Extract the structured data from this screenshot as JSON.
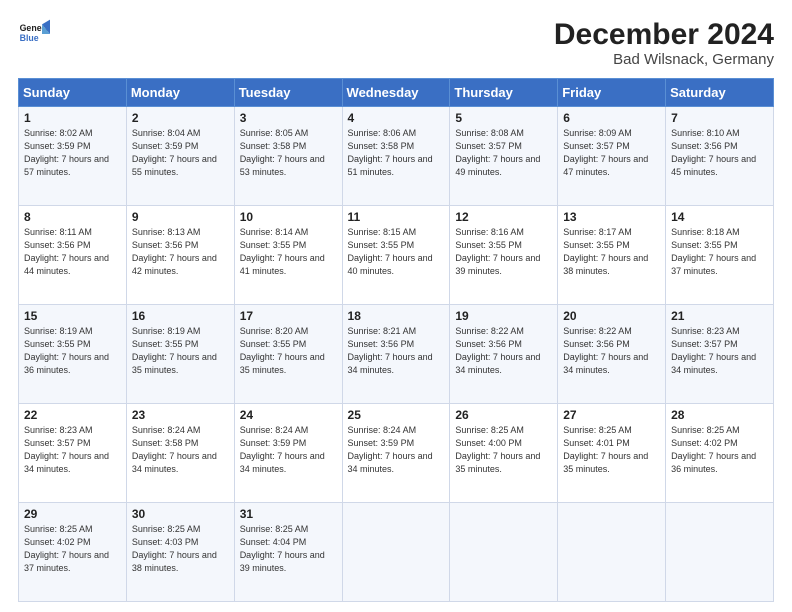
{
  "logo": {
    "line1": "General",
    "line2": "Blue"
  },
  "title": "December 2024",
  "subtitle": "Bad Wilsnack, Germany",
  "days": [
    "Sunday",
    "Monday",
    "Tuesday",
    "Wednesday",
    "Thursday",
    "Friday",
    "Saturday"
  ],
  "weeks": [
    [
      {
        "day": "1",
        "sunrise": "8:02 AM",
        "sunset": "3:59 PM",
        "daylight": "7 hours and 57 minutes."
      },
      {
        "day": "2",
        "sunrise": "8:04 AM",
        "sunset": "3:59 PM",
        "daylight": "7 hours and 55 minutes."
      },
      {
        "day": "3",
        "sunrise": "8:05 AM",
        "sunset": "3:58 PM",
        "daylight": "7 hours and 53 minutes."
      },
      {
        "day": "4",
        "sunrise": "8:06 AM",
        "sunset": "3:58 PM",
        "daylight": "7 hours and 51 minutes."
      },
      {
        "day": "5",
        "sunrise": "8:08 AM",
        "sunset": "3:57 PM",
        "daylight": "7 hours and 49 minutes."
      },
      {
        "day": "6",
        "sunrise": "8:09 AM",
        "sunset": "3:57 PM",
        "daylight": "7 hours and 47 minutes."
      },
      {
        "day": "7",
        "sunrise": "8:10 AM",
        "sunset": "3:56 PM",
        "daylight": "7 hours and 45 minutes."
      }
    ],
    [
      {
        "day": "8",
        "sunrise": "8:11 AM",
        "sunset": "3:56 PM",
        "daylight": "7 hours and 44 minutes."
      },
      {
        "day": "9",
        "sunrise": "8:13 AM",
        "sunset": "3:56 PM",
        "daylight": "7 hours and 42 minutes."
      },
      {
        "day": "10",
        "sunrise": "8:14 AM",
        "sunset": "3:55 PM",
        "daylight": "7 hours and 41 minutes."
      },
      {
        "day": "11",
        "sunrise": "8:15 AM",
        "sunset": "3:55 PM",
        "daylight": "7 hours and 40 minutes."
      },
      {
        "day": "12",
        "sunrise": "8:16 AM",
        "sunset": "3:55 PM",
        "daylight": "7 hours and 39 minutes."
      },
      {
        "day": "13",
        "sunrise": "8:17 AM",
        "sunset": "3:55 PM",
        "daylight": "7 hours and 38 minutes."
      },
      {
        "day": "14",
        "sunrise": "8:18 AM",
        "sunset": "3:55 PM",
        "daylight": "7 hours and 37 minutes."
      }
    ],
    [
      {
        "day": "15",
        "sunrise": "8:19 AM",
        "sunset": "3:55 PM",
        "daylight": "7 hours and 36 minutes."
      },
      {
        "day": "16",
        "sunrise": "8:19 AM",
        "sunset": "3:55 PM",
        "daylight": "7 hours and 35 minutes."
      },
      {
        "day": "17",
        "sunrise": "8:20 AM",
        "sunset": "3:55 PM",
        "daylight": "7 hours and 35 minutes."
      },
      {
        "day": "18",
        "sunrise": "8:21 AM",
        "sunset": "3:56 PM",
        "daylight": "7 hours and 34 minutes."
      },
      {
        "day": "19",
        "sunrise": "8:22 AM",
        "sunset": "3:56 PM",
        "daylight": "7 hours and 34 minutes."
      },
      {
        "day": "20",
        "sunrise": "8:22 AM",
        "sunset": "3:56 PM",
        "daylight": "7 hours and 34 minutes."
      },
      {
        "day": "21",
        "sunrise": "8:23 AM",
        "sunset": "3:57 PM",
        "daylight": "7 hours and 34 minutes."
      }
    ],
    [
      {
        "day": "22",
        "sunrise": "8:23 AM",
        "sunset": "3:57 PM",
        "daylight": "7 hours and 34 minutes."
      },
      {
        "day": "23",
        "sunrise": "8:24 AM",
        "sunset": "3:58 PM",
        "daylight": "7 hours and 34 minutes."
      },
      {
        "day": "24",
        "sunrise": "8:24 AM",
        "sunset": "3:59 PM",
        "daylight": "7 hours and 34 minutes."
      },
      {
        "day": "25",
        "sunrise": "8:24 AM",
        "sunset": "3:59 PM",
        "daylight": "7 hours and 34 minutes."
      },
      {
        "day": "26",
        "sunrise": "8:25 AM",
        "sunset": "4:00 PM",
        "daylight": "7 hours and 35 minutes."
      },
      {
        "day": "27",
        "sunrise": "8:25 AM",
        "sunset": "4:01 PM",
        "daylight": "7 hours and 35 minutes."
      },
      {
        "day": "28",
        "sunrise": "8:25 AM",
        "sunset": "4:02 PM",
        "daylight": "7 hours and 36 minutes."
      }
    ],
    [
      {
        "day": "29",
        "sunrise": "8:25 AM",
        "sunset": "4:02 PM",
        "daylight": "7 hours and 37 minutes."
      },
      {
        "day": "30",
        "sunrise": "8:25 AM",
        "sunset": "4:03 PM",
        "daylight": "7 hours and 38 minutes."
      },
      {
        "day": "31",
        "sunrise": "8:25 AM",
        "sunset": "4:04 PM",
        "daylight": "7 hours and 39 minutes."
      },
      null,
      null,
      null,
      null
    ]
  ]
}
